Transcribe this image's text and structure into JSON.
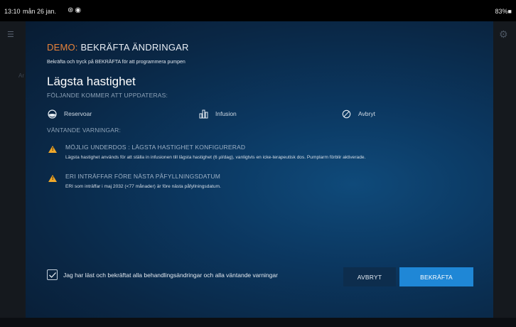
{
  "status_bar": {
    "time": "13:10",
    "date": "mån 26 jan.",
    "battery": "83%■"
  },
  "background": {
    "menu_glyph": "☰",
    "left_ghost": "Ar",
    "right_ghost": "⚙"
  },
  "dialog": {
    "demo_prefix": "DEMO:",
    "title": "BEKRÄFTA ÄNDRINGAR",
    "subtitle": "Bekräfta och tryck på BEKRÄFTA för att programmera pumpen",
    "heading": "Lägsta hastighet",
    "updates_label": "FÖLJANDE KOMMER ATT UPPDATERAS:",
    "updates": [
      {
        "label": "Reservoar",
        "icon": "reservoir-icon"
      },
      {
        "label": "Infusion",
        "icon": "infusion-icon"
      },
      {
        "label": "Avbryt",
        "icon": "cancel-circle-icon"
      }
    ],
    "warnings_label": "VÄNTANDE VARNINGAR:",
    "warnings": [
      {
        "title": "MÖJLIG UNDERDOS : LÄGSTA HASTIGHET KONFIGURERAD",
        "text": "Lägsta hastighet används för att ställa in infusionen till lägsta hastighet (6 µl/dag), vanligtvis en icke-terapeutisk dos. Pumplarm förblir aktiverade."
      },
      {
        "title": "ERI INTRÄFFAR FÖRE NÄSTA PÅFYLLNINGSDATUM",
        "text": "ERI som inträffar i maj 2032 (<77 månader) är före nästa påfyllningsdatum."
      }
    ],
    "checkbox_label": "Jag har läst och bekräftat alla behandlingsändringar och alla väntande varningar",
    "checkbox_checked": true,
    "cancel_label": "AVBRYT",
    "confirm_label": "BEKRÄFTA"
  },
  "colors": {
    "demo_accent": "#e8833a",
    "warning": "#f0a82a",
    "confirm_button": "#1f87d6",
    "cancel_button": "#0d2d4d"
  }
}
